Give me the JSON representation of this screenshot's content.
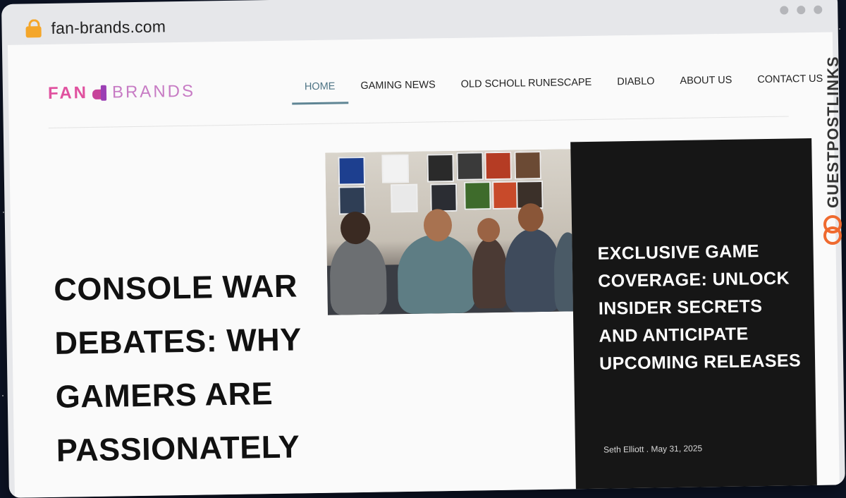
{
  "browser": {
    "url": "fan-brands.com"
  },
  "site": {
    "logo_fan": "FAN",
    "logo_brands": "BRANDS"
  },
  "nav": {
    "items": [
      {
        "label": "HOME"
      },
      {
        "label": "GAMING NEWS"
      },
      {
        "label": "OLD SCHOLL RUNESCAPE"
      },
      {
        "label": "DIABLO"
      },
      {
        "label": "ABOUT US"
      },
      {
        "label": "CONTACT US"
      }
    ],
    "active": "HOME"
  },
  "main_article": {
    "title": "Console War Debates: Why Gamers Are Passionately"
  },
  "featured_article": {
    "title": "Exclusive Game Coverage: Unlock Insider Secrets and Anticipate Upcoming Releases",
    "author": "Seth Elliott",
    "separator": ".",
    "date": "May 31, 2025"
  },
  "watermark": {
    "text": "GUESTPOSTLINKS"
  },
  "colors": {
    "accent_nav": "#5f8594",
    "logo_pink": "#e0519f",
    "logo_purple": "#9b3fb4",
    "feature_bg": "#161616",
    "watermark_orange": "#ef6a2f"
  }
}
